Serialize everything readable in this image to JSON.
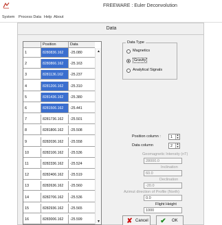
{
  "window": {
    "title": "FREEWARE : Euler Deconvolution",
    "menu": [
      "System",
      "Process Data",
      "Help",
      "About"
    ]
  },
  "data_panel": {
    "title": "Data"
  },
  "grid": {
    "columns": [
      "Position",
      "Data"
    ],
    "rows": [
      {
        "num": "1",
        "position": "8280836.162",
        "data": "-25.080",
        "selected": true
      },
      {
        "num": "2",
        "position": "8280866.162",
        "data": "-25.163",
        "selected": true
      },
      {
        "num": "3",
        "position": "8281136.162",
        "data": "-25.237",
        "selected": true
      },
      {
        "num": "4",
        "position": "8281206.162",
        "data": "-25.310",
        "selected": true
      },
      {
        "num": "5",
        "position": "8281436.162",
        "data": "-25.380",
        "selected": true
      },
      {
        "num": "6",
        "position": "8281506.162",
        "data": "-25.441",
        "selected": true
      },
      {
        "num": "7",
        "position": "8281736.162",
        "data": "-25.501",
        "selected": false
      },
      {
        "num": "8",
        "position": "8281806.162",
        "data": "-25.508",
        "selected": false
      },
      {
        "num": "9",
        "position": "8282036.162",
        "data": "-25.558",
        "selected": false
      },
      {
        "num": "10",
        "position": "8282106.162",
        "data": "-25.536",
        "selected": false
      },
      {
        "num": "11",
        "position": "8282336.162",
        "data": "-25.524",
        "selected": false
      },
      {
        "num": "12",
        "position": "8282406.162",
        "data": "-25.519",
        "selected": false
      },
      {
        "num": "13",
        "position": "8282636.162",
        "data": "-25.560",
        "selected": false
      },
      {
        "num": "14",
        "position": "8282706.162",
        "data": "-25.536",
        "selected": false
      },
      {
        "num": "15",
        "position": "8282936.162",
        "data": "-25.565",
        "selected": false
      },
      {
        "num": "16",
        "position": "8283006.162",
        "data": "-25.599",
        "selected": false
      }
    ]
  },
  "data_type": {
    "label": "Data Type",
    "options": [
      {
        "label": "Magnetics",
        "checked": false
      },
      {
        "label": "Gravity",
        "checked": true
      },
      {
        "label": "Analytical Signals",
        "checked": false
      }
    ]
  },
  "params": {
    "position_column_label": "Position column :",
    "position_column_value": "1",
    "data_column_label": "Data column",
    "data_column_value": "2",
    "intensity_label": "Geomagnetic Intensity (nT)",
    "intensity_value": "28000.0",
    "inclination_label": "Inclination",
    "inclination_value": "60.0",
    "declination_label": "Declination",
    "declination_value": "-20.0",
    "azimuth_label": "Azimut direction of Profile (North)",
    "azimuth_value": "0.0",
    "flight_height_label": "Flight Height",
    "flight_height_value": "1000"
  },
  "buttons": {
    "cancel": "Cancel",
    "ok": "OK"
  },
  "colors": {
    "selection": "#3b6fcf",
    "cancel_icon": "#cc1111",
    "ok_icon": "#1e8a1e"
  }
}
